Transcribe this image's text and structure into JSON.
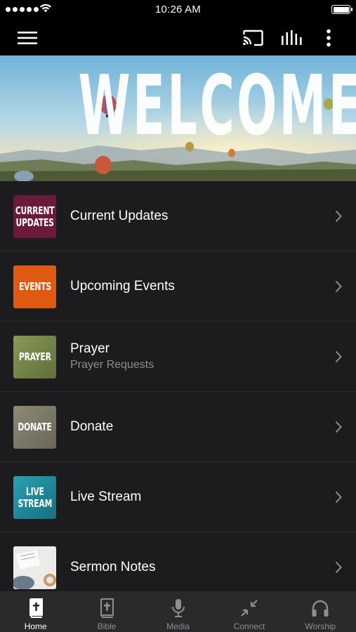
{
  "status_bar": {
    "time": "10:26 AM",
    "signal_bars": 5
  },
  "app_bar": {
    "icons": [
      "menu-icon",
      "cast-icon",
      "audio-bars-icon",
      "more-vertical-icon"
    ]
  },
  "banner": {
    "title": "WELCOME"
  },
  "list": {
    "items": [
      {
        "thumb_text": "CURRENT\nUPDATES",
        "title": "Current Updates",
        "subtitle": "",
        "thumb_color": "#6b1a3a"
      },
      {
        "thumb_text": "EVENTS",
        "title": "Upcoming Events",
        "subtitle": "",
        "thumb_color": "#e05a12"
      },
      {
        "thumb_text": "PRAYER",
        "title": "Prayer",
        "subtitle": "Prayer Requests",
        "thumb_color": "#7a8a48"
      },
      {
        "thumb_text": "DONATE",
        "title": "Donate",
        "subtitle": "",
        "thumb_color": "#7e7a68"
      },
      {
        "thumb_text": "LIVE\nSTREAM",
        "title": "Live Stream",
        "subtitle": "",
        "thumb_color": "#2590a2"
      },
      {
        "thumb_text": "",
        "title": "Sermon Notes",
        "subtitle": "",
        "thumb_color": "#e8e6e2"
      }
    ]
  },
  "tab_bar": {
    "tabs": [
      {
        "label": "Home",
        "icon": "home-bible-icon",
        "active": true
      },
      {
        "label": "Bible",
        "icon": "bible-icon",
        "active": false
      },
      {
        "label": "Media",
        "icon": "microphone-icon",
        "active": false
      },
      {
        "label": "Connect",
        "icon": "connect-arrows-icon",
        "active": false
      },
      {
        "label": "Worship",
        "icon": "headphones-icon",
        "active": false
      }
    ]
  },
  "colors": {
    "background": "#000000",
    "list_background": "#1c1c1e",
    "tab_bar_background": "#2a2a2c",
    "inactive_label": "#8e8e93"
  }
}
